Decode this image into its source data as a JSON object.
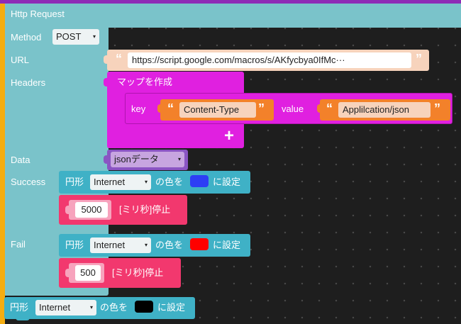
{
  "http": {
    "title": "Http Request",
    "method_label": "Method",
    "method_value": "POST",
    "url_label": "URL",
    "url_value": "https://script.google.com/macros/s/AKfycbya0IfMc···",
    "headers_label": "Headers",
    "data_label": "Data",
    "success_label": "Success",
    "fail_label": "Fail"
  },
  "map": {
    "title": "マップを作成",
    "key_label": "key",
    "key_value": "Content-Type",
    "value_label": "value",
    "value_value": "Applilcation/json",
    "add_symbol": "+"
  },
  "data_var": "jsonデータ",
  "quote_open": "“",
  "quote_close": "”",
  "dropdown_arrow": "▾",
  "success_set": {
    "prefix": "円形",
    "target": "Internet",
    "middle": "の色を",
    "suffix": "に設定",
    "color": "#2d3ef5"
  },
  "success_wait": {
    "value": "5000",
    "label": "[ミリ秒]停止"
  },
  "fail_set": {
    "prefix": "円形",
    "target": "Internet",
    "middle": "の色を",
    "suffix": "に設定",
    "color": "#ff0000"
  },
  "fail_wait": {
    "value": "500",
    "label": "[ミリ秒]停止"
  },
  "final_set": {
    "prefix": "円形",
    "target": "Internet",
    "middle": "の色を",
    "suffix": "に設定",
    "color": "#000000"
  },
  "colors": {
    "http_block": "#7ac3ca",
    "map_block": "#e020e0",
    "string_block": "#f3812a",
    "variable_block": "#8a55c3",
    "set_block": "#3fb1c6",
    "wait_block": "#f2386e",
    "event_hat": "#f5ad10"
  }
}
